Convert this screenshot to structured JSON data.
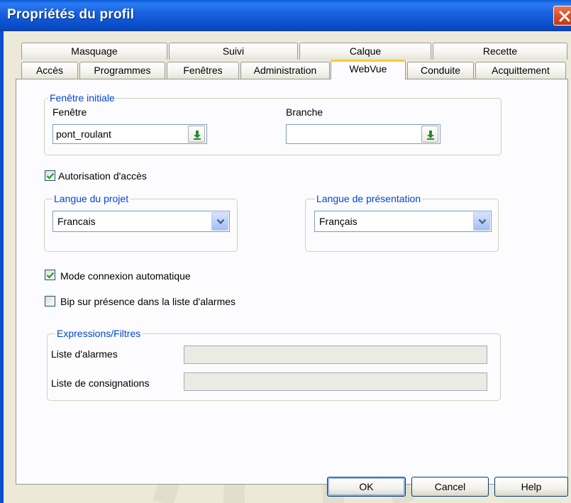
{
  "window": {
    "title": "Propriétés du profil"
  },
  "tabs": {
    "row_back": [
      {
        "label": "Masquage"
      },
      {
        "label": "Suivi"
      },
      {
        "label": "Calque"
      },
      {
        "label": "Recette"
      }
    ],
    "row_front": [
      {
        "label": "Accès"
      },
      {
        "label": "Programmes"
      },
      {
        "label": "Fenêtres"
      },
      {
        "label": "Administration"
      },
      {
        "label": "WebVue",
        "active": true
      },
      {
        "label": "Conduite"
      },
      {
        "label": "Acquittement"
      }
    ]
  },
  "initial_window": {
    "legend": "Fenêtre initiale",
    "window_label": "Fenêtre",
    "window_value": "pont_roulant",
    "branch_label": "Branche",
    "branch_value": ""
  },
  "access": {
    "label": "Autorisation d'accès",
    "checked": true
  },
  "project_language": {
    "legend": "Langue du projet",
    "selected": "Francais"
  },
  "presentation_language": {
    "legend": "Langue de présentation",
    "selected": "Français"
  },
  "auto_connect": {
    "label": "Mode connexion automatique",
    "checked": true
  },
  "alarm_beep": {
    "label": "Bip sur présence dans la liste d'alarmes",
    "checked": false
  },
  "expressions": {
    "legend": "Expressions/Filtres",
    "alarm_list_label": "Liste d'alarmes",
    "alarm_list_value": "",
    "log_list_label": "Liste de consignations",
    "log_list_value": ""
  },
  "buttons": {
    "ok": "OK",
    "cancel": "Cancel",
    "help": "Help"
  },
  "colors": {
    "titlebar": "#1b63e0",
    "legend": "#0046d5",
    "active_tab_accent": "#ffc83c"
  },
  "icons": {
    "close": "close-icon",
    "browse": "arrow-down-icon",
    "dropdown": "chevron-down-icon",
    "check": "check-icon"
  }
}
